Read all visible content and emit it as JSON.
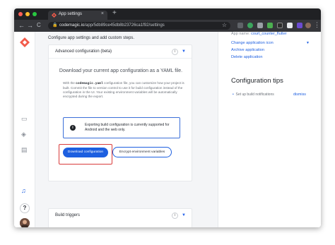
{
  "browser": {
    "tab_title": "App settings",
    "tab_close": "×",
    "new_tab": "+",
    "back": "←",
    "forward": "→",
    "reload": "C",
    "url_host": "codemagic.io",
    "url_path": "/app/5db89ce45db8b23726ca1f92/settings",
    "more_menu": "⋮"
  },
  "sidebar": {
    "help_label": "?"
  },
  "main": {
    "intro": "Configure app settings and add custom steps.",
    "advanced_card": {
      "title": "Advanced configuration (beta)",
      "info": "i",
      "caret": "▼",
      "lead": "Download your current app configuration as a YAML file.",
      "desc_before": "With the ",
      "desc_code": "codemagic.yaml",
      "desc_after": " configuration file, you can customize how your project is built. Commit the file to version control to use it for build configuration instead of the configuration in the UI. Your existing environment variables will be automatically encrypted during the export.",
      "notice_icon": "i",
      "notice_text": "Exporting build configuration is currently supported for Android and the web only.",
      "download_button": "Download configuration",
      "encrypt_button": "Encrypt environment variables"
    },
    "triggers_card": {
      "title": "Build triggers",
      "info": "i",
      "caret": "▼"
    }
  },
  "panel": {
    "app_name_label": "App name:",
    "app_name_value": "court_counter_flutter",
    "change_icon": "Change application icon",
    "dropdown": "▼",
    "archive": "Archive application",
    "delete": "Delete application",
    "tips_title": "Configuration tips",
    "tip_item": "Set up build notifications",
    "dismiss": "dismiss"
  },
  "colors": {
    "accent": "#1d5fe0",
    "highlight": "#d93b3b",
    "brand": "#f25b4a"
  }
}
